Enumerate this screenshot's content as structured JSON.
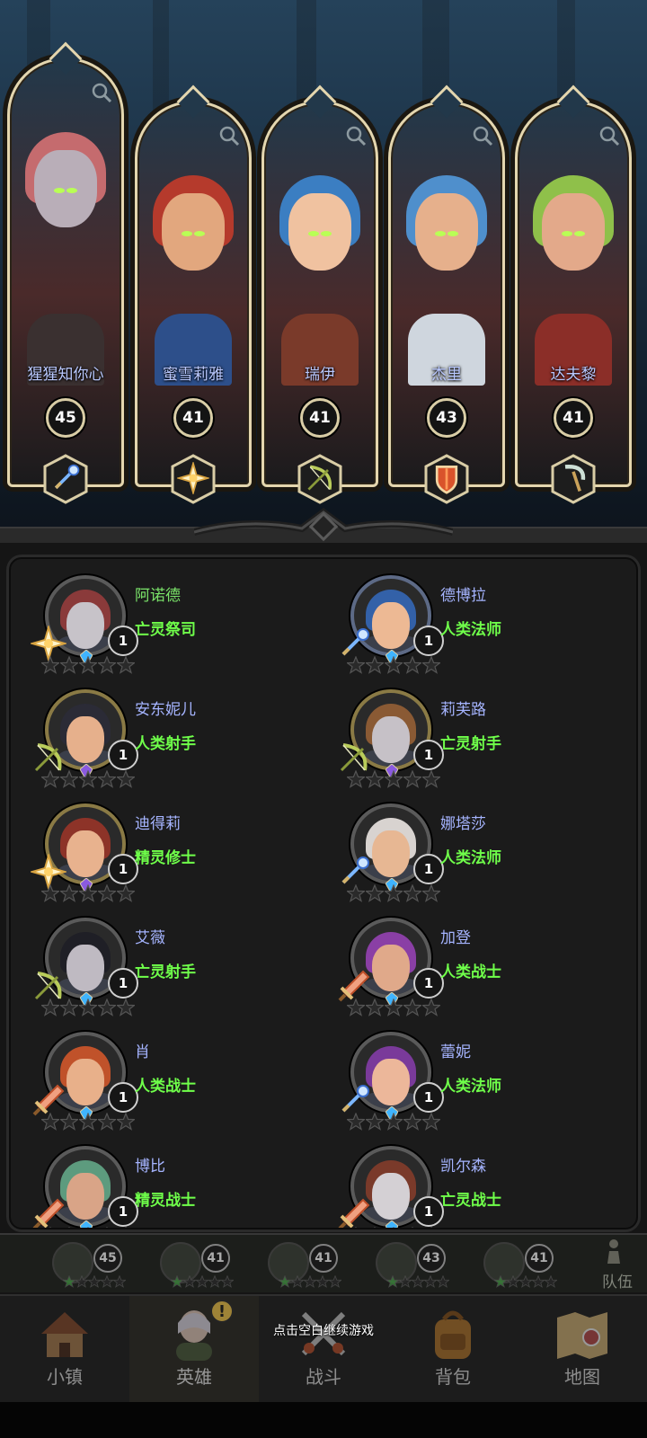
{
  "top_heroes": [
    {
      "name": "猩猩知你心",
      "level": "45",
      "class_icon": "staff-icon",
      "colors": {
        "hair": "#c56b6e",
        "skin": "#b9aeb8",
        "body": "#3a3030"
      }
    },
    {
      "name": "蜜雪莉雅",
      "level": "41",
      "class_icon": "holy-star-icon",
      "colors": {
        "hair": "#b53a2c",
        "skin": "#e2a77e",
        "body": "#2d4f8a"
      }
    },
    {
      "name": "瑞伊",
      "level": "41",
      "class_icon": "bow-icon",
      "colors": {
        "hair": "#3b7ec2",
        "skin": "#f0c2a0",
        "body": "#7a3a2a"
      }
    },
    {
      "name": "杰里",
      "level": "43",
      "class_icon": "shield-icon",
      "colors": {
        "hair": "#4f8fcc",
        "skin": "#e6b08c",
        "body": "#cfd6de"
      }
    },
    {
      "name": "达夫黎",
      "level": "41",
      "class_icon": "scythe-icon",
      "colors": {
        "hair": "#8fc04a",
        "skin": "#e3a98a",
        "body": "#8b2e28"
      }
    }
  ],
  "roster": [
    {
      "name": "阿诺德",
      "class": "亡灵祭司",
      "level": "1",
      "name_color": "green",
      "class_icon": "holy-star-icon",
      "ring": "plain",
      "colors": {
        "hair": "#8a3a3a",
        "skin": "#c7c3c9"
      }
    },
    {
      "name": "德博拉",
      "class": "人类法师",
      "level": "1",
      "name_color": "blue",
      "class_icon": "staff-icon",
      "ring": "blue",
      "colors": {
        "hair": "#3361a8",
        "skin": "#edb994"
      }
    },
    {
      "name": "安东妮儿",
      "class": "人类射手",
      "level": "1",
      "name_color": "blue",
      "class_icon": "bow-icon",
      "ring": "gold",
      "colors": {
        "hair": "#2b2b36",
        "skin": "#e6b08c"
      }
    },
    {
      "name": "莉芙路",
      "class": "亡灵射手",
      "level": "1",
      "name_color": "blue",
      "class_icon": "bow-icon",
      "ring": "gold",
      "colors": {
        "hair": "#8a5a34",
        "skin": "#c6c1c7"
      }
    },
    {
      "name": "迪得莉",
      "class": "精灵修士",
      "level": "1",
      "name_color": "blue",
      "class_icon": "holy-star-icon",
      "ring": "gold",
      "colors": {
        "hair": "#8d3328",
        "skin": "#e8b28e"
      }
    },
    {
      "name": "娜塔莎",
      "class": "人类法师",
      "level": "1",
      "name_color": "blue",
      "class_icon": "staff-icon",
      "ring": "plain",
      "colors": {
        "hair": "#d8d3d0",
        "skin": "#e7b793"
      }
    },
    {
      "name": "艾薇",
      "class": "亡灵射手",
      "level": "1",
      "name_color": "blue",
      "class_icon": "bow-icon",
      "ring": "plain",
      "colors": {
        "hair": "#1f1f26",
        "skin": "#bfbac2"
      }
    },
    {
      "name": "加登",
      "class": "人类战士",
      "level": "1",
      "name_color": "blue",
      "class_icon": "sword-icon",
      "ring": "plain",
      "colors": {
        "hair": "#8a3fa5",
        "skin": "#e0a98a"
      }
    },
    {
      "name": "肖",
      "class": "人类战士",
      "level": "1",
      "name_color": "blue",
      "class_icon": "sword-icon",
      "ring": "plain",
      "colors": {
        "hair": "#c0522a",
        "skin": "#e8b08a"
      }
    },
    {
      "name": "蕾妮",
      "class": "人类法师",
      "level": "1",
      "name_color": "blue",
      "class_icon": "staff-icon",
      "ring": "plain",
      "colors": {
        "hair": "#7a3a9a",
        "skin": "#ecb79a"
      }
    },
    {
      "name": "博比",
      "class": "精灵战士",
      "level": "1",
      "name_color": "blue",
      "class_icon": "sword-icon",
      "ring": "plain",
      "colors": {
        "hair": "#5d9b7e",
        "skin": "#d9a487"
      }
    },
    {
      "name": "凯尔森",
      "class": "亡灵战士",
      "level": "1",
      "name_color": "blue",
      "class_icon": "sword-icon",
      "ring": "plain",
      "colors": {
        "hair": "#7a3a2a",
        "skin": "#d4d0d4"
      }
    }
  ],
  "team_strip": {
    "levels": [
      "45",
      "41",
      "41",
      "43",
      "41"
    ],
    "label": "队伍"
  },
  "hint": "点击空白继续游戏",
  "nav": [
    {
      "label": "小镇",
      "icon": "town-icon"
    },
    {
      "label": "英雄",
      "icon": "hero-icon",
      "badge": "!"
    },
    {
      "label": "战斗",
      "icon": "swords-icon"
    },
    {
      "label": "背包",
      "icon": "backpack-icon"
    },
    {
      "label": "地图",
      "icon": "map-icon"
    }
  ],
  "colors": {
    "gold_frame": "#e4d6ae",
    "name_blue": "#a5b4ff",
    "name_green": "#7be46a",
    "class_green": "#6fff4a"
  }
}
